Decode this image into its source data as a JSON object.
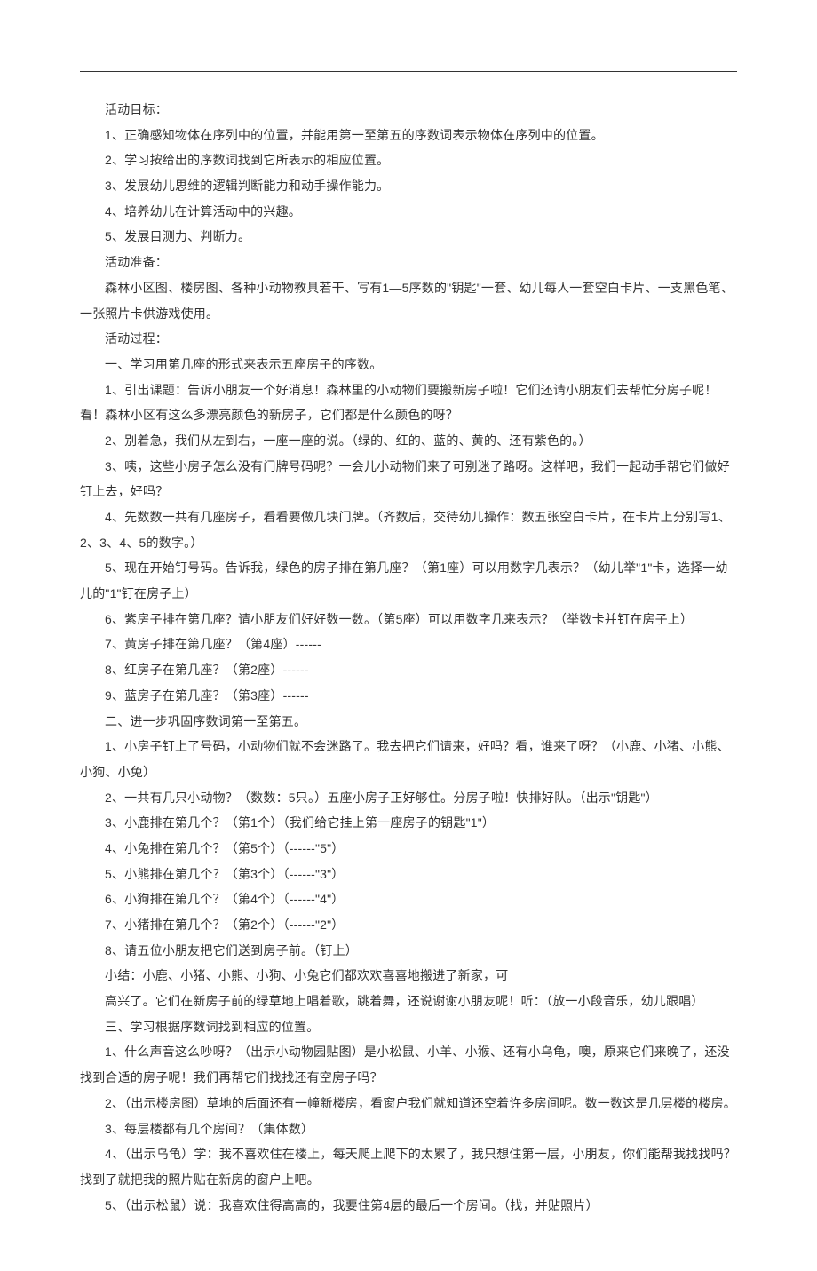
{
  "lines": [
    "活动目标：",
    "1、正确感知物体在序列中的位置，并能用第一至第五的序数词表示物体在序列中的位置。",
    "2、学习按给出的序数词找到它所表示的相应位置。",
    "3、发展幼儿思维的逻辑判断能力和动手操作能力。",
    "4、培养幼儿在计算活动中的兴趣。",
    "5、发展目测力、判断力。",
    "活动准备：",
    "森林小区图、楼房图、各种小动物教具若干、写有1—5序数的\"钥匙\"一套、幼儿每人一套空白卡片、一支黑色笔、一张照片卡供游戏使用。",
    "活动过程：",
    "一、学习用第几座的形式来表示五座房子的序数。",
    "1、引出课题：告诉小朋友一个好消息！森林里的小动物们要搬新房子啦！它们还请小朋友们去帮忙分房子呢！看！森林小区有这么多漂亮颜色的新房子，它们都是什么颜色的呀？",
    "2、别着急，我们从左到右，一座一座的说。（绿的、红的、蓝的、黄的、还有紫色的。）",
    "3、咦，这些小房子怎么没有门牌号码呢？一会儿小动物们来了可别迷了路呀。这样吧，我们一起动手帮它们做好钉上去，好吗？",
    "4、先数数一共有几座房子，看看要做几块门牌。（齐数后，交待幼儿操作：数五张空白卡片，在卡片上分别写1、2、3、4、5的数字。）",
    "5、现在开始钉号码。告诉我，绿色的房子排在第几座？（第1座）可以用数字几表示？（幼儿举\"1\"卡，选择一幼儿的\"1\"钉在房子上）",
    "6、紫房子排在第几座？请小朋友们好好数一数。（第5座）可以用数字几来表示？（举数卡并钉在房子上）",
    "7、黄房子排在第几座？（第4座）------",
    "8、红房子在第几座？（第2座）------",
    "9、蓝房子在第几座？（第3座）------",
    "二、进一步巩固序数词第一至第五。",
    "1、小房子钉上了号码，小动物们就不会迷路了。我去把它们请来，好吗？看，谁来了呀？（小鹿、小猪、小熊、小狗、小兔）",
    "2、一共有几只小动物？（数数：5只。）五座小房子正好够住。分房子啦！快排好队。（出示\"钥匙\"）",
    "3、小鹿排在第几个？（第1个）（我们给它挂上第一座房子的钥匙\"1\"）",
    "4、小兔排在第几个？（第5个）（------\"5\"）",
    "5、小熊排在第几个？（第3个）（------\"3\"）",
    "6、小狗排在第几个？（第4个）（------\"4\"）",
    "7、小猪排在第几个？（第2个）（------\"2\"）",
    "8、请五位小朋友把它们送到房子前。（钉上）",
    "小结：小鹿、小猪、小熊、小狗、小兔它们都欢欢喜喜地搬进了新家，可",
    "高兴了。它们在新房子前的绿草地上唱着歌，跳着舞，还说谢谢小朋友呢！听：（放一小段音乐，幼儿跟唱）",
    "三、学习根据序数词找到相应的位置。",
    "1、什么声音这么吵呀？（出示小动物园贴图）是小松鼠、小羊、小猴、还有小乌龟，噢，原来它们来晚了，还没找到合适的房子呢！我们再帮它们找找还有空房子吗？",
    "2、（出示楼房图）草地的后面还有一幢新楼房，看窗户我们就知道还空着许多房间呢。数一数这是几层楼的楼房。",
    "3、每层楼都有几个房间？（集体数）",
    "4、（出示乌龟）学：我不喜欢住在楼上，每天爬上爬下的太累了，我只想住第一层，小朋友，你们能帮我找找吗？找到了就把我的照片贴在新房的窗户上吧。",
    "5、（出示松鼠）说：我喜欢住得高高的，我要住第4层的最后一个房间。（找，并贴照片）"
  ],
  "wrap_flush": {
    "7": true,
    "10": true,
    "12": true,
    "13": true,
    "14": true,
    "20": true,
    "31": true,
    "34": true
  }
}
